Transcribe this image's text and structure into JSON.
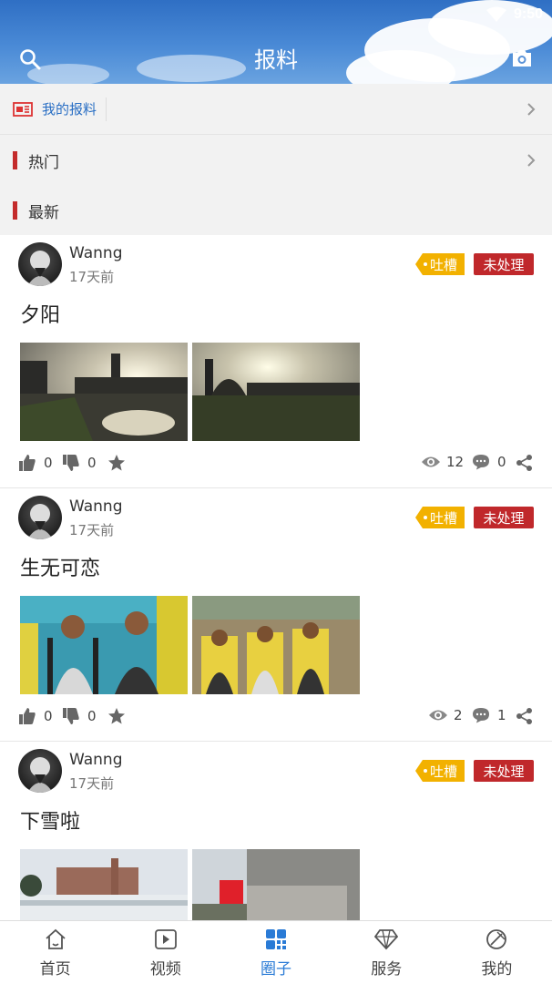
{
  "status": {
    "time": "9:50"
  },
  "header": {
    "title": "报料",
    "search_icon": "search-icon",
    "camera_icon": "camera-icon"
  },
  "sections": {
    "my_reports": "我的报料",
    "hot": "热门",
    "latest": "最新"
  },
  "posts": [
    {
      "username": "Wanng",
      "time": "17天前",
      "tag": "吐槽",
      "status": "未处理",
      "title": "夕阳",
      "likes": "0",
      "dislikes": "0",
      "views": "12",
      "comments": "0"
    },
    {
      "username": "Wanng",
      "time": "17天前",
      "tag": "吐槽",
      "status": "未处理",
      "title": "生无可恋",
      "likes": "0",
      "dislikes": "0",
      "views": "2",
      "comments": "1"
    },
    {
      "username": "Wanng",
      "time": "17天前",
      "tag": "吐槽",
      "status": "未处理",
      "title": "下雪啦",
      "likes": "",
      "dislikes": "",
      "views": "",
      "comments": ""
    }
  ],
  "nav": [
    {
      "label": "首页",
      "icon": "home-icon"
    },
    {
      "label": "视频",
      "icon": "video-icon"
    },
    {
      "label": "圈子",
      "icon": "grid-icon",
      "active": true
    },
    {
      "label": "服务",
      "icon": "diamond-icon"
    },
    {
      "label": "我的",
      "icon": "profile-icon"
    }
  ],
  "colors": {
    "accent": "#2a7bd6",
    "tag": "#f2b100",
    "status": "#c0282b",
    "header": "#3b7bcf"
  }
}
